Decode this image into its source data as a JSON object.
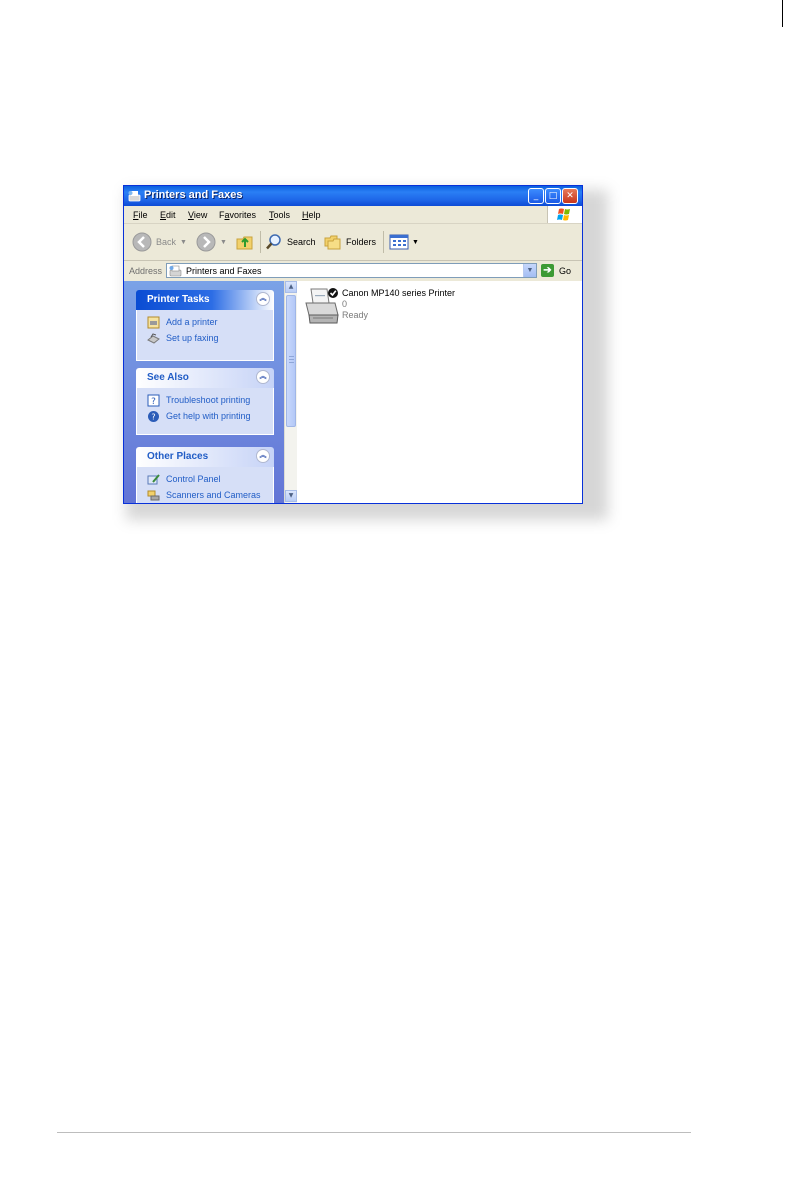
{
  "window": {
    "title": "Printers and Faxes"
  },
  "menu": {
    "items": [
      {
        "label": "File",
        "accel": "F",
        "rest": "ile"
      },
      {
        "label": "Edit",
        "accel": "E",
        "rest": "dit"
      },
      {
        "label": "View",
        "accel": "V",
        "rest": "iew"
      },
      {
        "label": "Favorites",
        "accel": "F",
        "rest": "a",
        "tail": "vorites"
      },
      {
        "label": "Tools",
        "accel": "T",
        "rest": "ools"
      },
      {
        "label": "Help",
        "accel": "H",
        "rest": "elp"
      }
    ]
  },
  "toolbar": {
    "back_label": "Back",
    "search_label": "Search",
    "folders_label": "Folders"
  },
  "address": {
    "label": "Address",
    "value": "Printers and Faxes",
    "go_label": "Go"
  },
  "tasks": {
    "printer_tasks": {
      "title": "Printer Tasks",
      "items": [
        "Add a printer",
        "Set up faxing"
      ]
    },
    "see_also": {
      "title": "See Also",
      "items": [
        "Troubleshoot printing",
        "Get help with printing"
      ]
    },
    "other_places": {
      "title": "Other Places",
      "items": [
        "Control Panel",
        "Scanners and Cameras"
      ]
    }
  },
  "printers": [
    {
      "name": "Canon MP140 series Printer",
      "documents": "0",
      "status": "Ready"
    }
  ],
  "colors": {
    "titlebar": "#0a5fde",
    "taskpane": "#6375d6",
    "link": "#215dc6",
    "window_face": "#ece9d8"
  }
}
